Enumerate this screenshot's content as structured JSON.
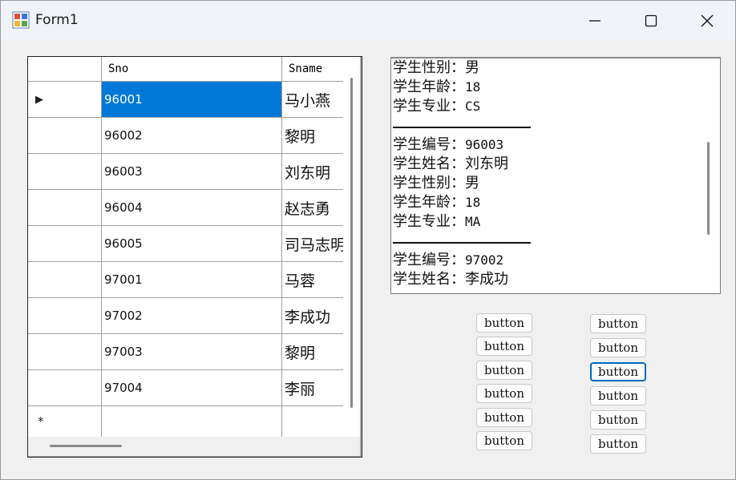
{
  "window": {
    "title": "Form1"
  },
  "grid": {
    "columns": [
      "Sno",
      "Sname"
    ],
    "rows": [
      {
        "sno": "96001",
        "sname": "马小燕"
      },
      {
        "sno": "96002",
        "sname": "黎明"
      },
      {
        "sno": "96003",
        "sname": "刘东明"
      },
      {
        "sno": "96004",
        "sname": "赵志勇"
      },
      {
        "sno": "96005",
        "sname": "司马志明"
      },
      {
        "sno": "97001",
        "sname": "马蓉"
      },
      {
        "sno": "97002",
        "sname": "李成功"
      },
      {
        "sno": "97003",
        "sname": "黎明"
      },
      {
        "sno": "97004",
        "sname": "李丽"
      }
    ],
    "selected_row_marker": "▶",
    "new_row_marker": "*"
  },
  "textbox": {
    "lines": [
      {
        "label": "学生性别：",
        "value": "男"
      },
      {
        "label": "学生年龄：",
        "value": "18"
      },
      {
        "label": "学生专业：",
        "value": "CS"
      },
      {
        "separator": true
      },
      {
        "label": "学生编号：",
        "value": "96003"
      },
      {
        "label": "学生姓名：",
        "value": "刘东明"
      },
      {
        "label": "学生性别：",
        "value": "男"
      },
      {
        "label": "学生年龄：",
        "value": "18"
      },
      {
        "label": "学生专业：",
        "value": "MA"
      },
      {
        "separator": true
      },
      {
        "label": "学生编号：",
        "value": "97002"
      },
      {
        "label": "学生姓名：",
        "value": "李成功"
      }
    ]
  },
  "buttons": {
    "left": [
      "button",
      "button",
      "button",
      "button",
      "button",
      "button"
    ],
    "right": [
      "button",
      "button",
      "button",
      "button",
      "button",
      "button"
    ]
  },
  "colors": {
    "selection": "#0078d7",
    "focus_border": "#0067c0"
  }
}
